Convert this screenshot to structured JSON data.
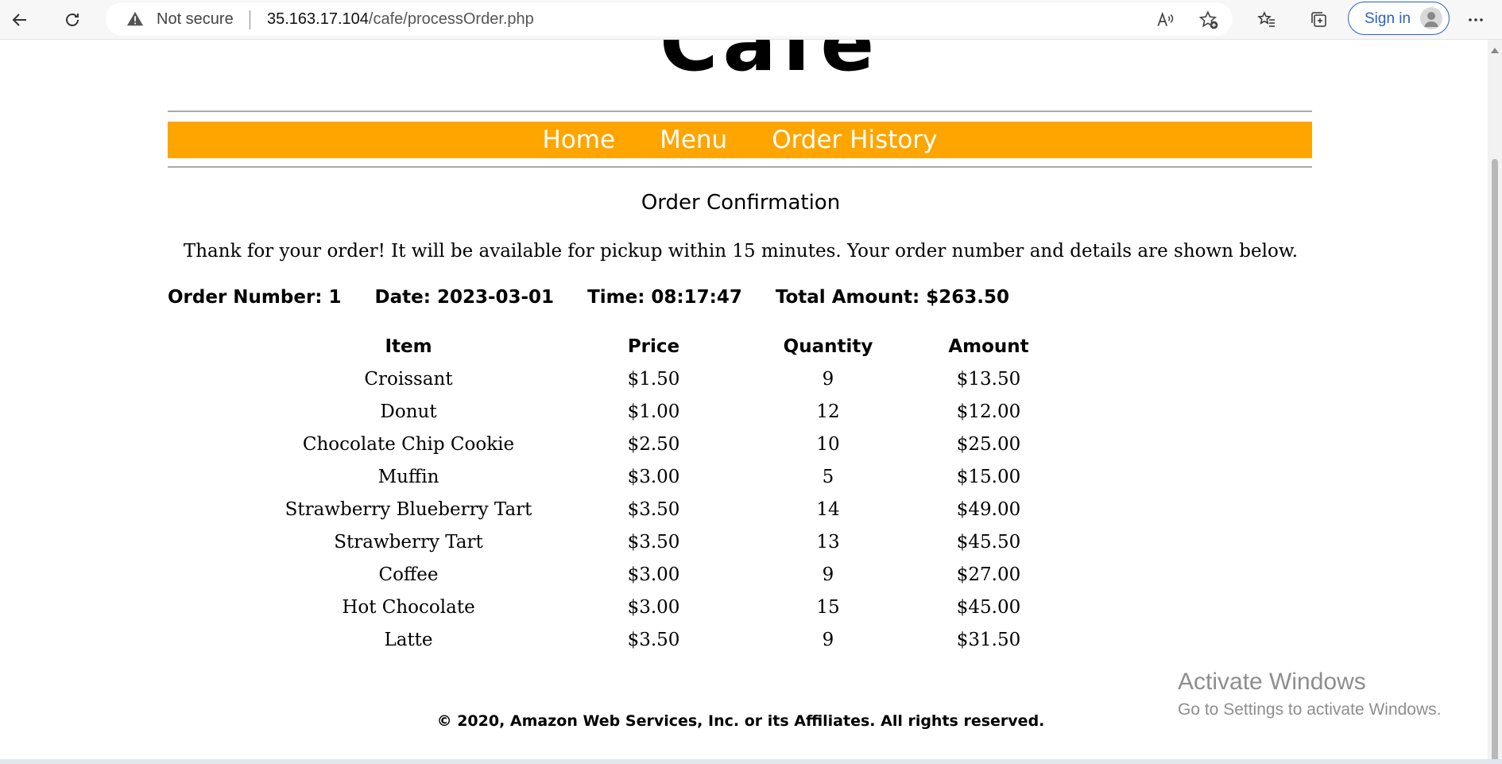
{
  "browser": {
    "security_label": "Not secure",
    "url_host": "35.163.17.104",
    "url_path": "/cafe/processOrder.php",
    "signin_label": "Sign in",
    "icons": [
      "back-arrow-icon",
      "refresh-icon",
      "warning-icon",
      "read-aloud-icon",
      "add-favorite-icon",
      "favorites-icon",
      "collections-icon",
      "profile-icon",
      "more-icon"
    ]
  },
  "site": {
    "logo_text": "Cafe",
    "nav": [
      {
        "label": "Home"
      },
      {
        "label": "Menu"
      },
      {
        "label": "Order History"
      }
    ],
    "accent_color": "#ffa500"
  },
  "confirmation": {
    "title": "Order Confirmation",
    "message": "Thank for your order! It will be available for pickup within 15 minutes. Your order number and details are shown below.",
    "order_number": "Order Number: 1",
    "date": "Date: 2023-03-01",
    "time": "Time: 08:17:47",
    "total": "Total Amount: $263.50"
  },
  "order_table": {
    "headers": [
      "Item",
      "Price",
      "Quantity",
      "Amount"
    ],
    "rows": [
      [
        "Croissant",
        "$1.50",
        "9",
        "$13.50"
      ],
      [
        "Donut",
        "$1.00",
        "12",
        "$12.00"
      ],
      [
        "Chocolate Chip Cookie",
        "$2.50",
        "10",
        "$25.00"
      ],
      [
        "Muffin",
        "$3.00",
        "5",
        "$15.00"
      ],
      [
        "Strawberry Blueberry Tart",
        "$3.50",
        "14",
        "$49.00"
      ],
      [
        "Strawberry Tart",
        "$3.50",
        "13",
        "$45.50"
      ],
      [
        "Coffee",
        "$3.00",
        "9",
        "$27.00"
      ],
      [
        "Hot Chocolate",
        "$3.00",
        "15",
        "$45.00"
      ],
      [
        "Latte",
        "$3.50",
        "9",
        "$31.50"
      ]
    ]
  },
  "footer": {
    "copyright": "© 2020, Amazon Web Services, Inc. or its Affiliates. All rights reserved."
  },
  "watermark": {
    "line1": "Activate Windows",
    "line2": "Go to Settings to activate Windows."
  }
}
